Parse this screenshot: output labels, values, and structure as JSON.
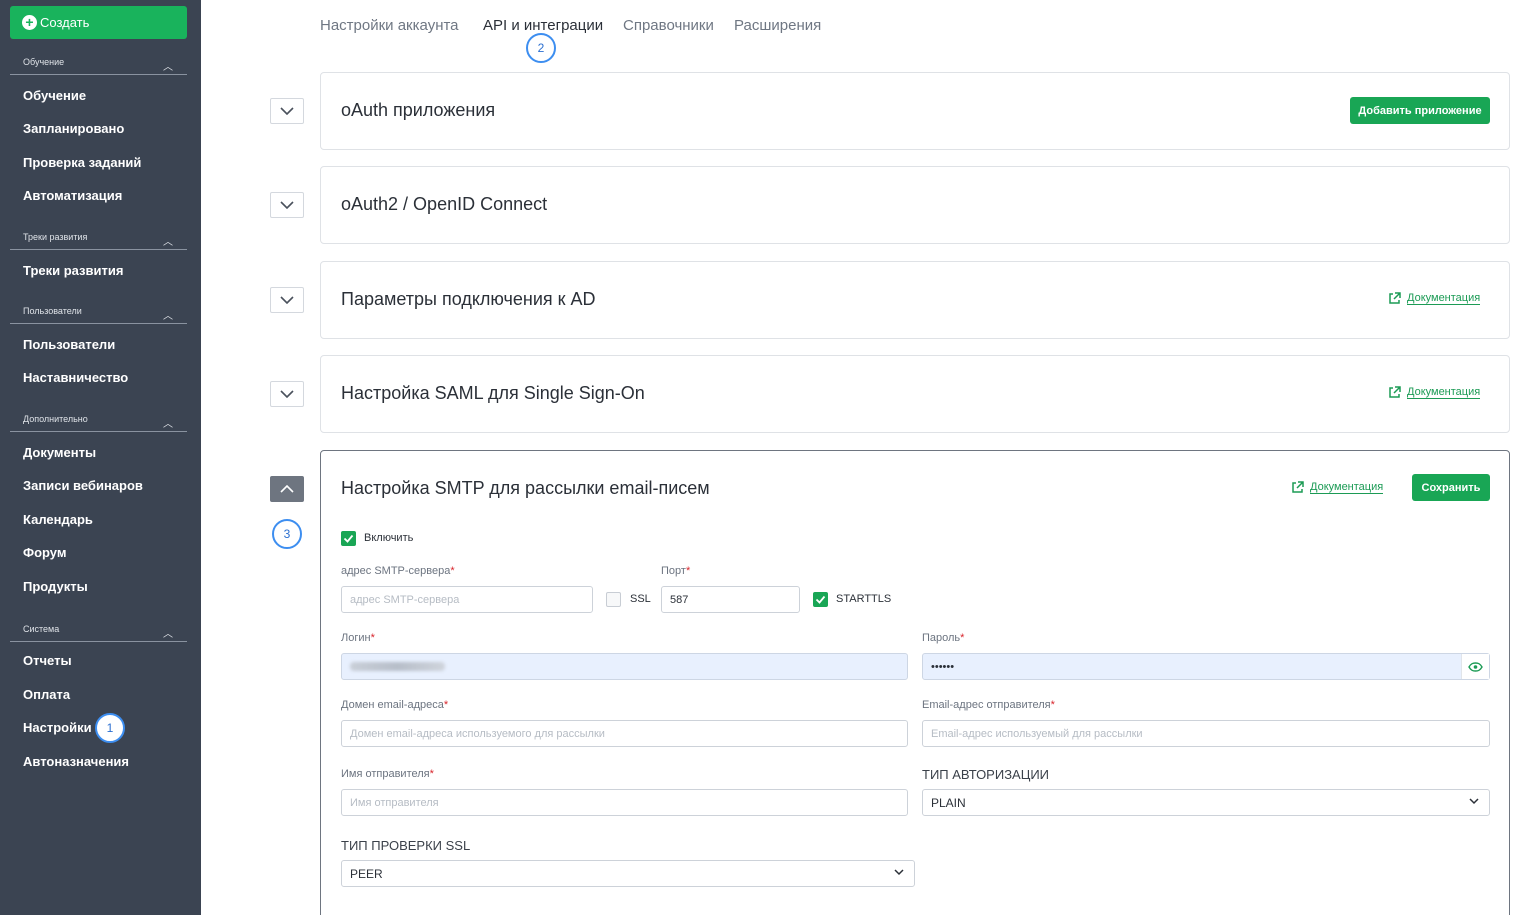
{
  "sidebar": {
    "create_label": "Создать",
    "sections": [
      {
        "title": "Обучение",
        "items": [
          "Обучение",
          "Запланировано",
          "Проверка заданий",
          "Автоматизация"
        ]
      },
      {
        "title": "Треки развития",
        "items": [
          "Треки развития"
        ]
      },
      {
        "title": "Пользователи",
        "items": [
          "Пользователи",
          "Наставничество"
        ]
      },
      {
        "title": "Дополнительно",
        "items": [
          "Документы",
          "Записи вебинаров",
          "Календарь",
          "Форум",
          "Продукты"
        ]
      },
      {
        "title": "Система",
        "items": [
          "Отчеты",
          "Оплата",
          "Настройки",
          "Автоназначения"
        ]
      }
    ]
  },
  "tabs": [
    "Настройки аккаунта",
    "API и интеграции",
    "Справочники",
    "Расширения"
  ],
  "badges": {
    "settings": "1",
    "api_tab": "2",
    "smtp": "3"
  },
  "panels": {
    "oauth": {
      "title": "oAuth приложения",
      "button": "Добавить приложение"
    },
    "oauth2": {
      "title": "oAuth2 / OpenID Connect"
    },
    "ad": {
      "title": "Параметры подключения к AD",
      "doc": "Документация"
    },
    "saml": {
      "title": "Настройка SAML для Single Sign-On",
      "doc": "Документация"
    },
    "smtp": {
      "title": "Настройка SMTP для рассылки email-писем",
      "doc": "Документация",
      "save": "Сохранить"
    }
  },
  "form": {
    "enable_label": "Включить",
    "smtp_server_label": "адрес SMTP-сервера",
    "smtp_server_placeholder": "адрес SMTP-сервера",
    "ssl_label": "SSL",
    "port_label": "Порт",
    "port_value": "587",
    "starttls_label": "STARTTLS",
    "login_label": "Логин",
    "password_label": "Пароль",
    "password_value": "••••••",
    "domain_label": "Домен email-адреса",
    "domain_placeholder": "Домен email-адреса используемого для рассылки",
    "sender_email_label": "Email-адрес отправителя",
    "sender_email_placeholder": "Email-адрес используемый для рассылки",
    "sender_name_label": "Имя отправителя",
    "sender_name_placeholder": "Имя отправителя",
    "auth_type_label": "ТИП АВТОРИЗАЦИИ",
    "auth_type_value": "PLAIN",
    "ssl_check_label": "ТИП ПРОВЕРКИ SSL",
    "ssl_check_value": "PEER",
    "required_mark": "*"
  },
  "colors": {
    "sidebar_bg": "#3b4452",
    "accent_green": "#19a655",
    "badge_blue": "#3d8ef0",
    "required_red": "#d8242b"
  }
}
